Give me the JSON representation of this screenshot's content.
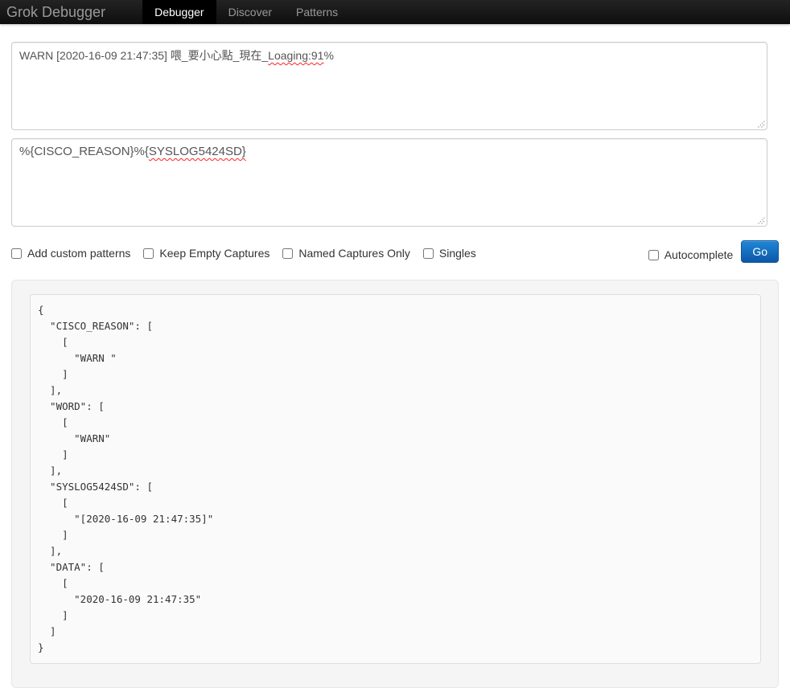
{
  "navbar": {
    "brand": "Grok Debugger",
    "tabs": [
      {
        "label": "Debugger",
        "active": true
      },
      {
        "label": "Discover",
        "active": false
      },
      {
        "label": "Patterns",
        "active": false
      }
    ]
  },
  "log_input": {
    "value": "WARN [2020-16-09 21:47:35] 喂_要小心點_現在_Loaging:91%",
    "segments": [
      "WARN [2020-16-09 21:47:35] 喂_要小心點_現在_",
      "Loaging:91",
      "%"
    ]
  },
  "pattern_input": {
    "value": "%{CISCO_REASON}%{SYSLOG5424SD}",
    "segments": [
      "%{CISCO_REASON}%{",
      "SYSLOG5424SD}"
    ]
  },
  "options": {
    "checkboxes": [
      {
        "label": "Add custom patterns",
        "checked": false
      },
      {
        "label": "Keep Empty Captures",
        "checked": false
      },
      {
        "label": "Named Captures Only",
        "checked": false
      },
      {
        "label": "Singles",
        "checked": false
      }
    ],
    "autocomplete": {
      "label": "Autocomplete",
      "checked": false
    },
    "go_label": "Go"
  },
  "output": {
    "json_text": "{\n  \"CISCO_REASON\": [\n    [\n      \"WARN \"\n    ]\n  ],\n  \"WORD\": [\n    [\n      \"WARN\"\n    ]\n  ],\n  \"SYSLOG5424SD\": [\n    [\n      \"[2020-16-09 21:47:35]\"\n    ]\n  ],\n  \"DATA\": [\n    [\n      \"2020-16-09 21:47:35\"\n    ]\n  ]\n}"
  },
  "colors": {
    "navbar_bg": "#111111",
    "navbar_text": "#999999",
    "active_tab_bg": "#000000",
    "active_tab_text": "#ffffff",
    "go_button_blue": "#1177d1",
    "spellcheck_red": "#ff2222",
    "panel_bg": "#f5f5f5",
    "pre_bg": "#fafafa",
    "input_text": "#555555"
  }
}
